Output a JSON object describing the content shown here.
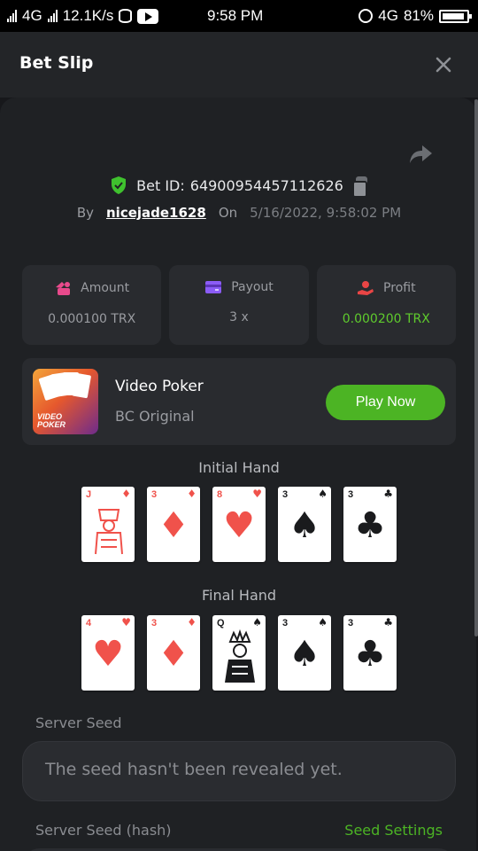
{
  "status": {
    "network_left": "4G",
    "speed": "12.1K/s",
    "time": "9:58 PM",
    "network_right": "4G",
    "battery": "81%"
  },
  "header": {
    "title": "Bet Slip"
  },
  "bet": {
    "id_label": "Bet ID:",
    "id_value": "64900954457112626",
    "by_label": "By",
    "user": "nicejade1628",
    "on_label": "On",
    "date": "5/16/2022, 9:58:02 PM"
  },
  "stats": [
    {
      "label": "Amount",
      "value": "0.000100 TRX",
      "icon": "amount-icon"
    },
    {
      "label": "Payout",
      "value": "3 x",
      "icon": "payout-card-icon"
    },
    {
      "label": "Profit",
      "value": "0.000200 TRX",
      "icon": "profit-icon"
    }
  ],
  "game": {
    "name": "Video Poker",
    "subtitle": "BC Original",
    "thumb_text_1": "VIDEO",
    "thumb_text_2": "POKER",
    "play_label": "Play Now"
  },
  "initial_hand": {
    "title": "Initial Hand",
    "cards": [
      {
        "rank": "J",
        "suit": "♦",
        "color": "red"
      },
      {
        "rank": "3",
        "suit": "♦",
        "color": "red"
      },
      {
        "rank": "8",
        "suit": "♥",
        "color": "red"
      },
      {
        "rank": "3",
        "suit": "♠",
        "color": "black"
      },
      {
        "rank": "3",
        "suit": "♣",
        "color": "black"
      }
    ]
  },
  "final_hand": {
    "title": "Final Hand",
    "cards": [
      {
        "rank": "4",
        "suit": "♥",
        "color": "red"
      },
      {
        "rank": "3",
        "suit": "♦",
        "color": "red"
      },
      {
        "rank": "Q",
        "suit": "♠",
        "color": "black"
      },
      {
        "rank": "3",
        "suit": "♠",
        "color": "black"
      },
      {
        "rank": "3",
        "suit": "♣",
        "color": "black"
      }
    ]
  },
  "server_seed": {
    "label": "Server Seed",
    "value": "The seed hasn't been revealed yet."
  },
  "server_seed_hash": {
    "label": "Server Seed (hash)",
    "settings_label": "Seed Settings"
  },
  "colors": {
    "accent_green": "#4cb424",
    "profit_green": "#5fcb2d",
    "panel": "#1f2124"
  }
}
